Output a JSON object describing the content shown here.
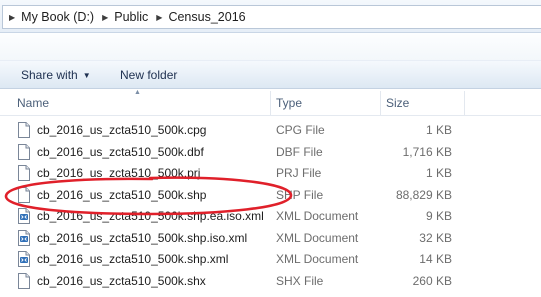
{
  "address_bar": {
    "crumbs": [
      "My Book (D:)",
      "Public",
      "Census_2016"
    ]
  },
  "toolbar": {
    "share_label": "Share with",
    "new_folder_label": "New folder"
  },
  "columns": {
    "name": "Name",
    "type": "Type",
    "size": "Size"
  },
  "files": [
    {
      "name": "cb_2016_us_zcta510_500k.cpg",
      "type": "CPG File",
      "size": "1 KB",
      "icon": "blank-file-icon"
    },
    {
      "name": "cb_2016_us_zcta510_500k.dbf",
      "type": "DBF File",
      "size": "1,716 KB",
      "icon": "blank-file-icon"
    },
    {
      "name": "cb_2016_us_zcta510_500k.prj",
      "type": "PRJ File",
      "size": "1 KB",
      "icon": "blank-file-icon"
    },
    {
      "name": "cb_2016_us_zcta510_500k.shp",
      "type": "SHP File",
      "size": "88,829 KB",
      "icon": "blank-file-icon"
    },
    {
      "name": "cb_2016_us_zcta510_500k.shp.ea.iso.xml",
      "type": "XML Document",
      "size": "9 KB",
      "icon": "xml-document-icon"
    },
    {
      "name": "cb_2016_us_zcta510_500k.shp.iso.xml",
      "type": "XML Document",
      "size": "32 KB",
      "icon": "xml-document-icon"
    },
    {
      "name": "cb_2016_us_zcta510_500k.shp.xml",
      "type": "XML Document",
      "size": "14 KB",
      "icon": "xml-document-icon"
    },
    {
      "name": "cb_2016_us_zcta510_500k.shx",
      "type": "SHX File",
      "size": "260 KB",
      "icon": "blank-file-icon"
    }
  ],
  "annotation": {
    "highlighted_file": "cb_2016_us_zcta510_500k.shp",
    "color": "#e0202a"
  }
}
